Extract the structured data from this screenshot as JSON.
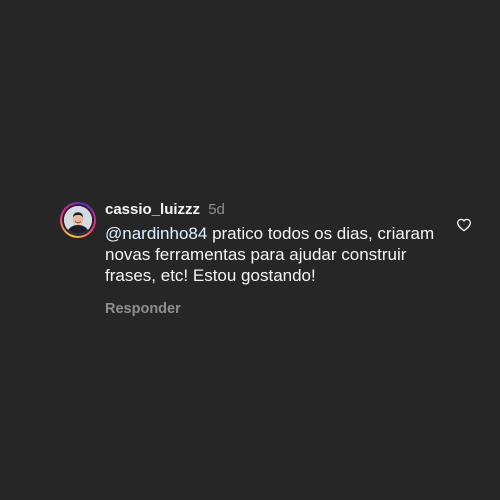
{
  "comment": {
    "username": "cassio_luizzz",
    "time": "5d",
    "mention": "@nardinho84",
    "text": " pratico todos os dias, criaram novas ferramentas para ajudar construir frases, etc! Estou gostando!",
    "reply_label": "Responder",
    "avatar_icon": "user-avatar-photo",
    "like_icon": "heart-outline-icon"
  },
  "colors": {
    "background": "#262626",
    "text": "#f5f5f5",
    "secondary": "#8e8e8e",
    "mention": "#e0f1ff"
  }
}
